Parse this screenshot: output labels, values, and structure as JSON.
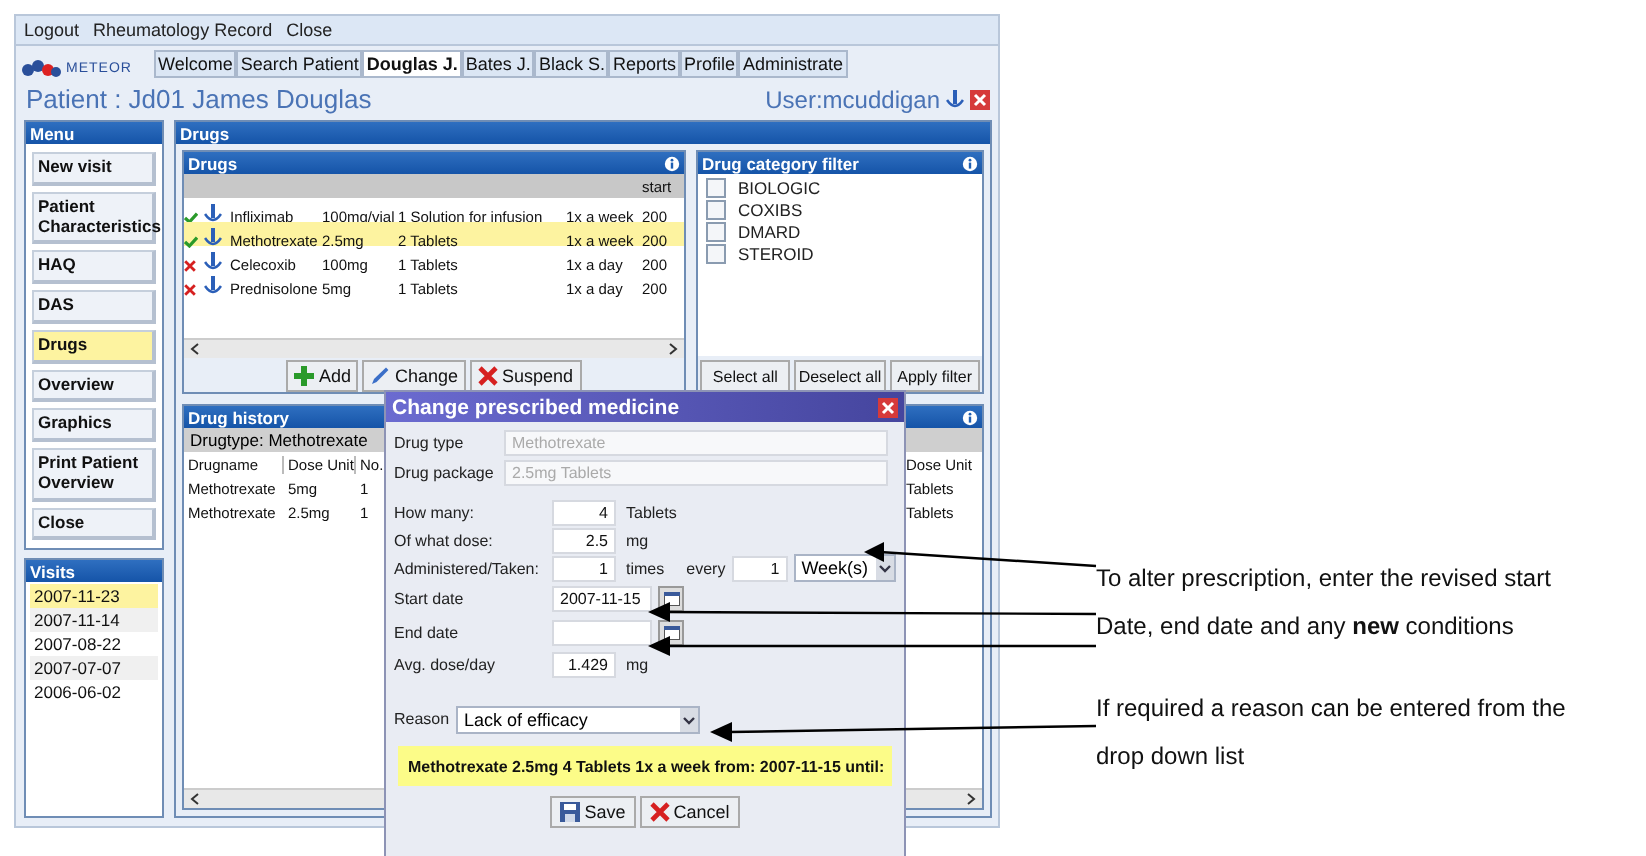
{
  "menu_bar": [
    "Logout",
    "Rheumatology Record",
    "Close"
  ],
  "logo": {
    "text": "METEOR"
  },
  "tabs": [
    {
      "label": "Welcome",
      "selected": false
    },
    {
      "label": "Search Patient",
      "selected": false
    },
    {
      "label": "Douglas J.",
      "selected": true
    },
    {
      "label": "Bates J.",
      "selected": false
    },
    {
      "label": "Black S.",
      "selected": false
    },
    {
      "label": "Reports",
      "selected": false
    },
    {
      "label": "Profile",
      "selected": false
    },
    {
      "label": "Administrate",
      "selected": false
    }
  ],
  "patient": {
    "title": "Patient : Jd01 James Douglas",
    "user": "User:mcuddigan"
  },
  "menu": {
    "title": "Menu",
    "items": [
      {
        "label": "New visit",
        "selected": false
      },
      {
        "label": "Patient Characteristics",
        "selected": false
      },
      {
        "label": "HAQ",
        "selected": false
      },
      {
        "label": "DAS",
        "selected": false
      },
      {
        "label": "Drugs",
        "selected": true
      },
      {
        "label": "Overview",
        "selected": false
      },
      {
        "label": "Graphics",
        "selected": false
      },
      {
        "label": "Print Patient Overview",
        "selected": false
      },
      {
        "label": "Close",
        "selected": false
      }
    ]
  },
  "visits": {
    "title": "Visits",
    "items": [
      {
        "label": "2007-11-23",
        "selected": true
      },
      {
        "label": "2007-11-14",
        "selected": false
      },
      {
        "label": "2007-08-22",
        "selected": false
      },
      {
        "label": "2007-07-07",
        "selected": false
      },
      {
        "label": "2006-06-02",
        "selected": false
      }
    ]
  },
  "drugs_panel": {
    "title": "Drugs",
    "drugs": {
      "title": "Drugs",
      "column_7": "start",
      "rows": [
        {
          "active": true,
          "selected": false,
          "cells": [
            "Infliximab",
            "100mg/vial",
            "1 Solution for infusion",
            "1x a week",
            "200"
          ]
        },
        {
          "active": true,
          "selected": true,
          "cells": [
            "Methotrexate",
            "2.5mg",
            "2 Tablets",
            "1x a week",
            "200"
          ]
        },
        {
          "active": false,
          "selected": false,
          "cells": [
            "Celecoxib",
            "100mg",
            "1 Tablets",
            "1x a day",
            "200"
          ]
        },
        {
          "active": false,
          "selected": false,
          "cells": [
            "Prednisolone",
            "5mg",
            "1 Tablets",
            "1x a day",
            "200"
          ]
        }
      ],
      "buttons": [
        {
          "kind": "add",
          "label": "Add"
        },
        {
          "kind": "change",
          "label": "Change"
        },
        {
          "kind": "suspend",
          "label": "Suspend"
        }
      ]
    },
    "filter": {
      "title": "Drug category filter",
      "categories": [
        {
          "label": "BIOLOGIC",
          "checked": false
        },
        {
          "label": "COXIBS",
          "checked": false
        },
        {
          "label": "DMARD",
          "checked": false
        },
        {
          "label": "STEROID",
          "checked": false
        }
      ],
      "buttons": [
        "Select all",
        "Deselect all",
        "Apply filter"
      ]
    },
    "history": {
      "title": "Drug history",
      "drugtype": "Drugtype: Methotrexate",
      "columns": [
        "Drugname",
        "Dose Unit",
        "No."
      ],
      "right_column": "Dose Unit",
      "rows": [
        {
          "cells": [
            "Methotrexate",
            "5mg",
            "1"
          ],
          "right": "Tablets"
        },
        {
          "cells": [
            "Methotrexate",
            "2.5mg",
            "1"
          ],
          "right": "Tablets"
        }
      ]
    }
  },
  "dialog": {
    "title": "Change prescribed medicine",
    "drug_type": {
      "label": "Drug type",
      "value": "Methotrexate",
      "disabled": true
    },
    "drug_package": {
      "label": "Drug package",
      "value": "2.5mg Tablets",
      "disabled": true
    },
    "how_many": {
      "label": "How many:",
      "value": "4",
      "unit": "Tablets"
    },
    "dose": {
      "label": "Of what dose:",
      "value": "2.5",
      "unit": "mg"
    },
    "administered": {
      "label": "Administered/Taken:",
      "value": "1",
      "unit": "times",
      "every_label": "every",
      "every_value": "1",
      "period": "Week(s)"
    },
    "start_date": {
      "label": "Start date",
      "value": "2007-11-15"
    },
    "end_date": {
      "label": "End date"
    },
    "avg": {
      "label": "Avg. dose/day",
      "value": "1.429",
      "unit": "mg"
    },
    "reason": {
      "label": "Reason",
      "value": "Lack of efficacy"
    },
    "summary": "Methotrexate 2.5mg 4 Tablets 1x a week from: 2007-11-15 until:",
    "buttons": [
      {
        "kind": "save",
        "label": "Save"
      },
      {
        "kind": "cancel",
        "label": "Cancel"
      }
    ]
  },
  "annotations": [
    {
      "lines": [
        "To alter prescription, enter the revised start",
        "Date, end date and any **new** conditions"
      ]
    },
    {
      "lines": [
        "If required a reason can be entered from the",
        "drop down list"
      ]
    }
  ]
}
